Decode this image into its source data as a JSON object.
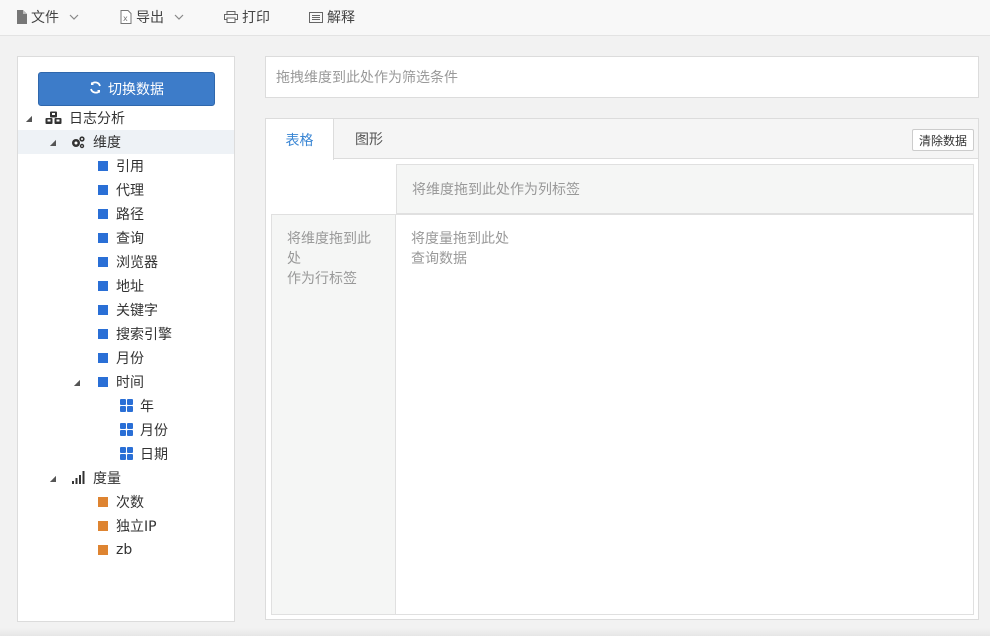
{
  "menu": {
    "file": "文件",
    "export": "导出",
    "print": "打印",
    "explain": "解释"
  },
  "sidebar": {
    "switch_button": "切换数据",
    "tree": {
      "root": "日志分析",
      "dimensions": {
        "label": "维度",
        "items": [
          "引用",
          "代理",
          "路径",
          "查询",
          "浏览器",
          "地址",
          "关键字",
          "搜索引擎",
          "月份"
        ],
        "time": {
          "label": "时间",
          "children": [
            "年",
            "月份",
            "日期"
          ]
        }
      },
      "measures": {
        "label": "度量",
        "items": [
          "次数",
          "独立IP",
          "zb"
        ]
      }
    }
  },
  "filter": {
    "placeholder": "拖拽维度到此处作为筛选条件"
  },
  "main": {
    "tabs": [
      "表格",
      "图形"
    ],
    "clear_button": "清除数据",
    "column_drop": "将维度拖到此处作为列标签",
    "row_drop": [
      "将维度拖到此",
      "处",
      "作为行标签"
    ],
    "data_area": [
      "将度量拖到此处",
      "查询数据"
    ]
  },
  "colors": {
    "accent": "#3d7cc9",
    "dimension": "#2a6fd6",
    "measure": "#de8431",
    "active_tab": "#3a86d4"
  }
}
